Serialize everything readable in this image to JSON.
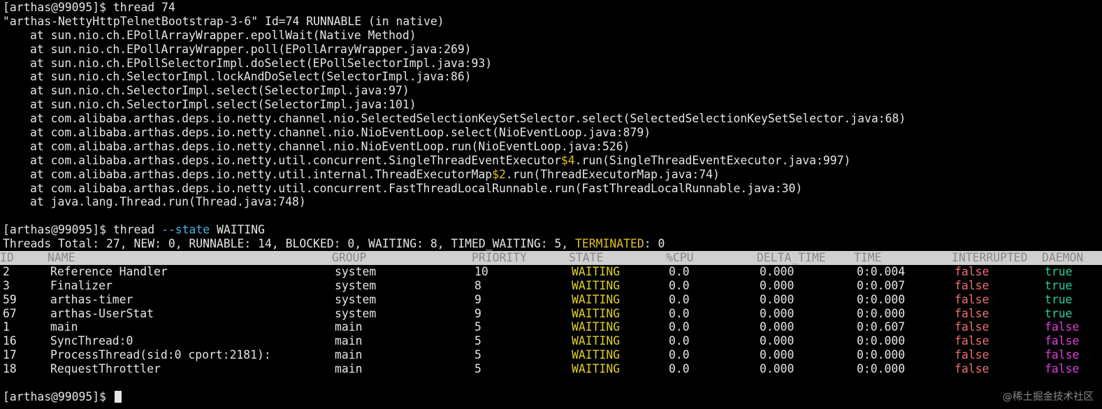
{
  "terminal": {
    "session1": {
      "prompt": "[arthas@99095]$",
      "command": "thread 74",
      "thread_header": "\"arthas-NettyHttpTelnetBootstrap-3-6\" Id=74 RUNNABLE (in native)",
      "stack": [
        "at sun.nio.ch.EPollArrayWrapper.epollWait(Native Method)",
        "at sun.nio.ch.EPollArrayWrapper.poll(EPollArrayWrapper.java:269)",
        "at sun.nio.ch.EPollSelectorImpl.doSelect(EPollSelectorImpl.java:93)",
        "at sun.nio.ch.SelectorImpl.lockAndDoSelect(SelectorImpl.java:86)",
        "at sun.nio.ch.SelectorImpl.select(SelectorImpl.java:97)",
        "at sun.nio.ch.SelectorImpl.select(SelectorImpl.java:101)",
        "at com.alibaba.arthas.deps.io.netty.channel.nio.SelectedSelectionKeySetSelector.select(SelectedSelectionKeySetSelector.java:68)",
        "at com.alibaba.arthas.deps.io.netty.channel.nio.NioEventLoop.select(NioEventLoop.java:879)",
        "at com.alibaba.arthas.deps.io.netty.channel.nio.NioEventLoop.run(NioEventLoop.java:526)",
        {
          "before": "at com.alibaba.arthas.deps.io.netty.util.concurrent.SingleThreadEventExecutor",
          "hl": "$4",
          "after": ".run(SingleThreadEventExecutor.java:997)"
        },
        {
          "before": "at com.alibaba.arthas.deps.io.netty.util.internal.ThreadExecutorMap",
          "hl": "$2",
          "after": ".run(ThreadExecutorMap.java:74)"
        },
        "at com.alibaba.arthas.deps.io.netty.util.concurrent.FastThreadLocalRunnable.run(FastThreadLocalRunnable.java:30)",
        "at java.lang.Thread.run(Thread.java:748)"
      ]
    },
    "session2": {
      "prompt": "[arthas@99095]$",
      "command_base": "thread",
      "command_option": "--state",
      "command_arg": "WAITING",
      "summary_prefix": "Threads Total: 27, NEW: 0, RUNNABLE: 14, BLOCKED: 0, WAITING: 8, TIMED_WAITING: 5, ",
      "summary_terminated_label": "TERMINATED",
      "summary_suffix": ": 0",
      "table": {
        "headers": {
          "id": "ID",
          "name": "NAME",
          "group": "GROUP",
          "priority": "PRIORITY",
          "state": "STATE",
          "cpu": "%CPU",
          "delta_time": "DELTA_TIME",
          "time": "TIME",
          "interrupted": "INTERRUPTED",
          "daemon": "DAEMON"
        },
        "rows": [
          {
            "id": "2",
            "name": "Reference Handler",
            "group": "system",
            "priority": "10",
            "state": "WAITING",
            "cpu": "0.0",
            "delta_time": "0.000",
            "time": "0:0.004",
            "interrupted": "false",
            "daemon": "true"
          },
          {
            "id": "3",
            "name": "Finalizer",
            "group": "system",
            "priority": "8",
            "state": "WAITING",
            "cpu": "0.0",
            "delta_time": "0.000",
            "time": "0:0.007",
            "interrupted": "false",
            "daemon": "true"
          },
          {
            "id": "59",
            "name": "arthas-timer",
            "group": "system",
            "priority": "9",
            "state": "WAITING",
            "cpu": "0.0",
            "delta_time": "0.000",
            "time": "0:0.000",
            "interrupted": "false",
            "daemon": "true"
          },
          {
            "id": "67",
            "name": "arthas-UserStat",
            "group": "system",
            "priority": "9",
            "state": "WAITING",
            "cpu": "0.0",
            "delta_time": "0.000",
            "time": "0:0.000",
            "interrupted": "false",
            "daemon": "true"
          },
          {
            "id": "1",
            "name": "main",
            "group": "main",
            "priority": "5",
            "state": "WAITING",
            "cpu": "0.0",
            "delta_time": "0.000",
            "time": "0:0.607",
            "interrupted": "false",
            "daemon": "false"
          },
          {
            "id": "16",
            "name": "SyncThread:0",
            "group": "main",
            "priority": "5",
            "state": "WAITING",
            "cpu": "0.0",
            "delta_time": "0.000",
            "time": "0:0.000",
            "interrupted": "false",
            "daemon": "false"
          },
          {
            "id": "17",
            "name": "ProcessThread(sid:0 cport:2181):",
            "group": "main",
            "priority": "5",
            "state": "WAITING",
            "cpu": "0.0",
            "delta_time": "0.000",
            "time": "0:0.000",
            "interrupted": "false",
            "daemon": "false"
          },
          {
            "id": "18",
            "name": "RequestThrottler",
            "group": "main",
            "priority": "5",
            "state": "WAITING",
            "cpu": "0.0",
            "delta_time": "0.000",
            "time": "0:0.000",
            "interrupted": "false",
            "daemon": "false"
          }
        ]
      }
    },
    "session3": {
      "prompt": "[arthas@99095]$"
    }
  },
  "watermark": "@稀土掘金技术社区",
  "colors": {
    "background": "#000000",
    "text": "#e6e6e6",
    "highlight_yellow": "#e0c020",
    "option_blue": "#4ab0e8",
    "header_bg": "#d0d0d0",
    "header_text": "#888888",
    "false_red": "#f07070",
    "true_green": "#20d0a0",
    "false_magenta": "#e040e0"
  }
}
